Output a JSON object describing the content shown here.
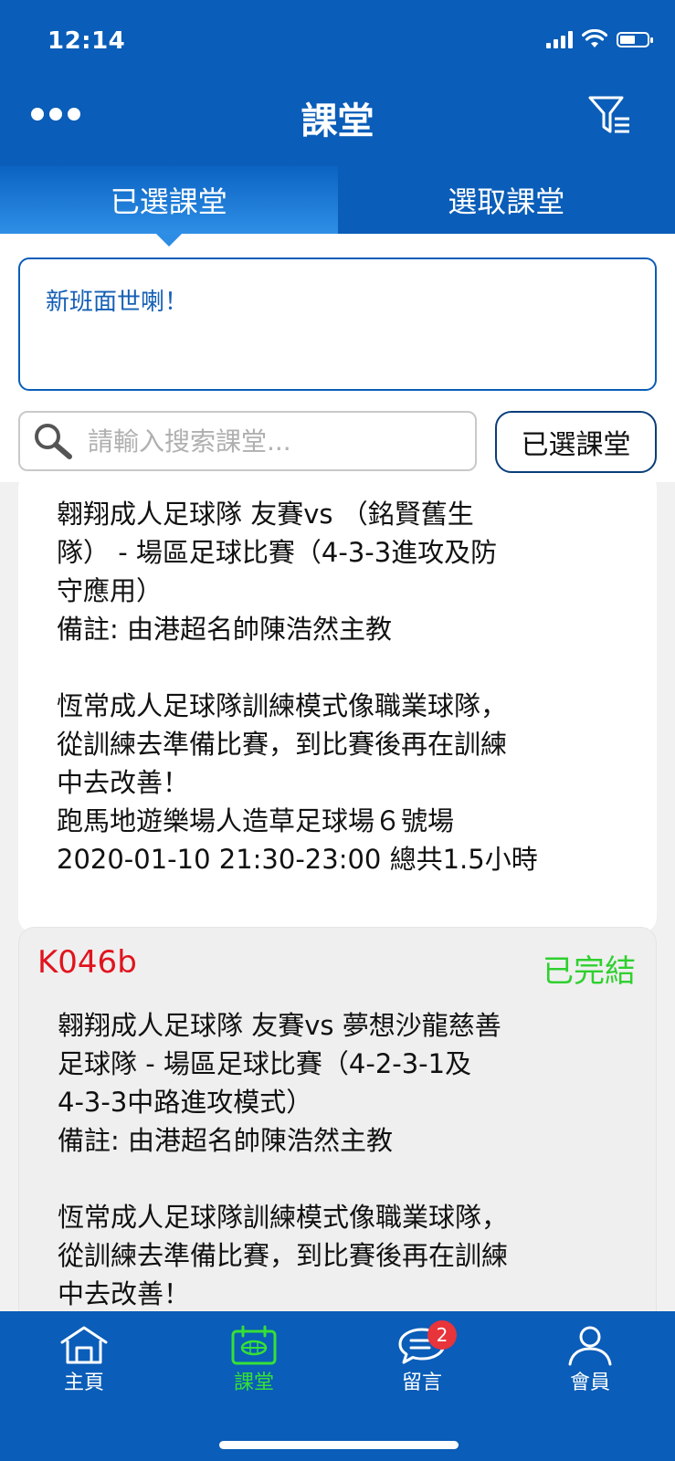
{
  "status": {
    "time": "12:14"
  },
  "header": {
    "title": "課堂",
    "more_icon": "more-dots-icon",
    "filter_icon": "filter-icon"
  },
  "tabs": [
    {
      "label": "已選課堂",
      "active": true
    },
    {
      "label": "選取課堂",
      "active": false
    }
  ],
  "notice": {
    "text": "新班面世喇！"
  },
  "search": {
    "placeholder": "請輸入搜索課堂...",
    "value": ""
  },
  "selected_button": {
    "label": "已選課堂"
  },
  "cards": [
    {
      "code": "",
      "status": "",
      "lines": [
        "翱翔成人足球隊 友賽vs （銘賢舊生",
        "隊） - 場區足球比賽（4-3-3進攻及防",
        "守應用）",
        "備註: 由港超名帥陳浩然主教",
        "",
        "恆常成人足球隊訓練模式像職業球隊，",
        "從訓練去準備比賽，到比賽後再在訓練",
        "中去改善！",
        "跑馬地遊樂場人造草足球場６號場",
        "2020-01-10 21:30-23:00 總共1.5小時"
      ]
    },
    {
      "code": "K046b",
      "status": "已完結",
      "lines": [
        "翱翔成人足球隊 友賽vs 夢想沙龍慈善",
        "足球隊 - 場區足球比賽（4-2-3-1及",
        "4-3-3中路進攻模式）",
        "備註: 由港超名帥陳浩然主教",
        "",
        "恆常成人足球隊訓練模式像職業球隊，",
        "從訓練去準備比賽，到比賽後再在訓練",
        "中去改善！"
      ]
    }
  ],
  "bottom_nav": [
    {
      "label": "主頁",
      "icon": "home-icon",
      "active": false
    },
    {
      "label": "課堂",
      "icon": "calendar-icon",
      "active": true
    },
    {
      "label": "留言",
      "icon": "chat-icon",
      "active": false,
      "badge": "2"
    },
    {
      "label": "會員",
      "icon": "user-icon",
      "active": false
    }
  ],
  "colors": {
    "primary": "#0a5db8",
    "code_red": "#e0141e",
    "status_green": "#2fd02f",
    "active_nav": "#36e036",
    "badge": "#e8343b"
  }
}
